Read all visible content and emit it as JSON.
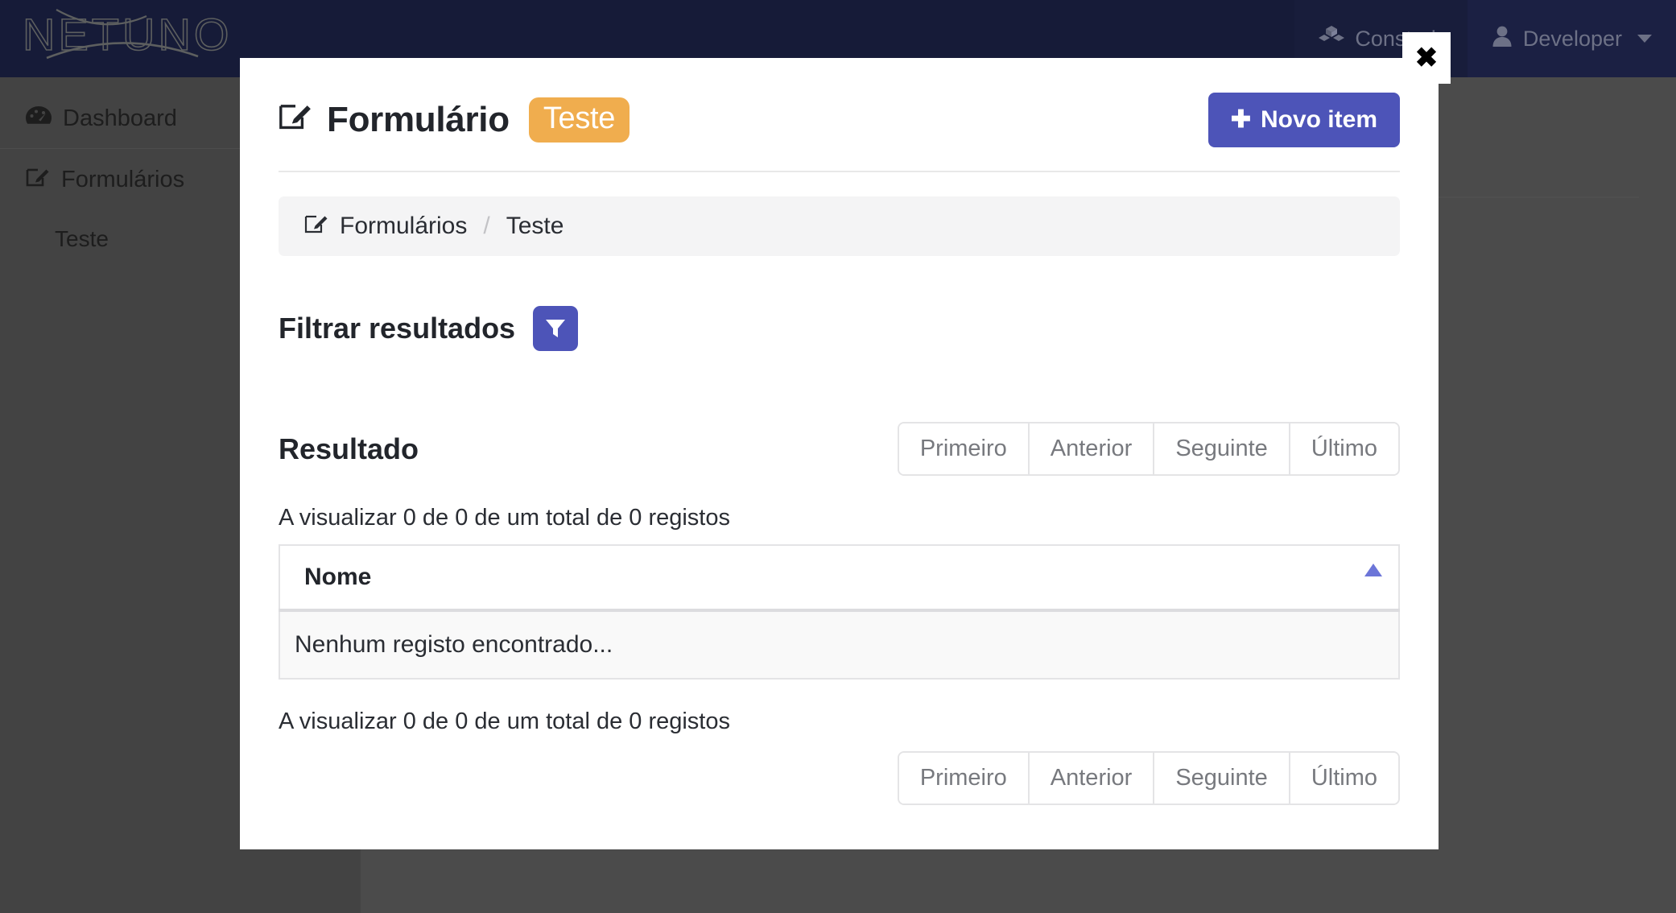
{
  "navbar": {
    "brand": "NETUNO",
    "links": [
      {
        "id": "construir",
        "label": "Construir",
        "icon": "cubes-icon"
      },
      {
        "id": "developer",
        "label": "Developer",
        "icon": "user-icon"
      }
    ]
  },
  "sidebar": {
    "items": [
      {
        "label": "Dashboard",
        "icon": "dashboard-icon",
        "sub": false
      },
      {
        "label": "Formulários",
        "icon": "edit-square-icon",
        "sub": false
      },
      {
        "label": "Teste",
        "icon": "",
        "sub": true
      }
    ]
  },
  "modal": {
    "close_label": "✖",
    "title": "Formulário",
    "title_icon": "edit-square-icon",
    "title_badge": "Teste",
    "new_item_button": "Novo item",
    "new_item_icon": "plus-icon",
    "breadcrumb": {
      "icon": "edit-square-icon",
      "parent": "Formulários",
      "separator": "/",
      "current": "Teste"
    },
    "filter": {
      "heading": "Filtrar resultados",
      "toggle_icon": "funnel-icon"
    },
    "result": {
      "heading": "Resultado",
      "pagination": [
        "Primeiro",
        "Anterior",
        "Seguinte",
        "Último"
      ],
      "records_info_top": "A visualizar 0 de 0 de um total de 0 registos",
      "records_info_bottom": "A visualizar 0 de 0 de um total de 0 registos",
      "table": {
        "columns": [
          "Nome"
        ],
        "sort_indicator": "sort-asc-icon",
        "empty_message": "Nenhum registo encontrado..."
      }
    }
  },
  "colors": {
    "navbar_bg": "#161b38",
    "sidebar_bg": "#434343",
    "content_bg": "#4b4b4b",
    "primary": "#4d54b8",
    "badge_warning": "#f0ad4e",
    "sort_indicator": "#6c75d8",
    "modal_bg": "#ffffff"
  }
}
